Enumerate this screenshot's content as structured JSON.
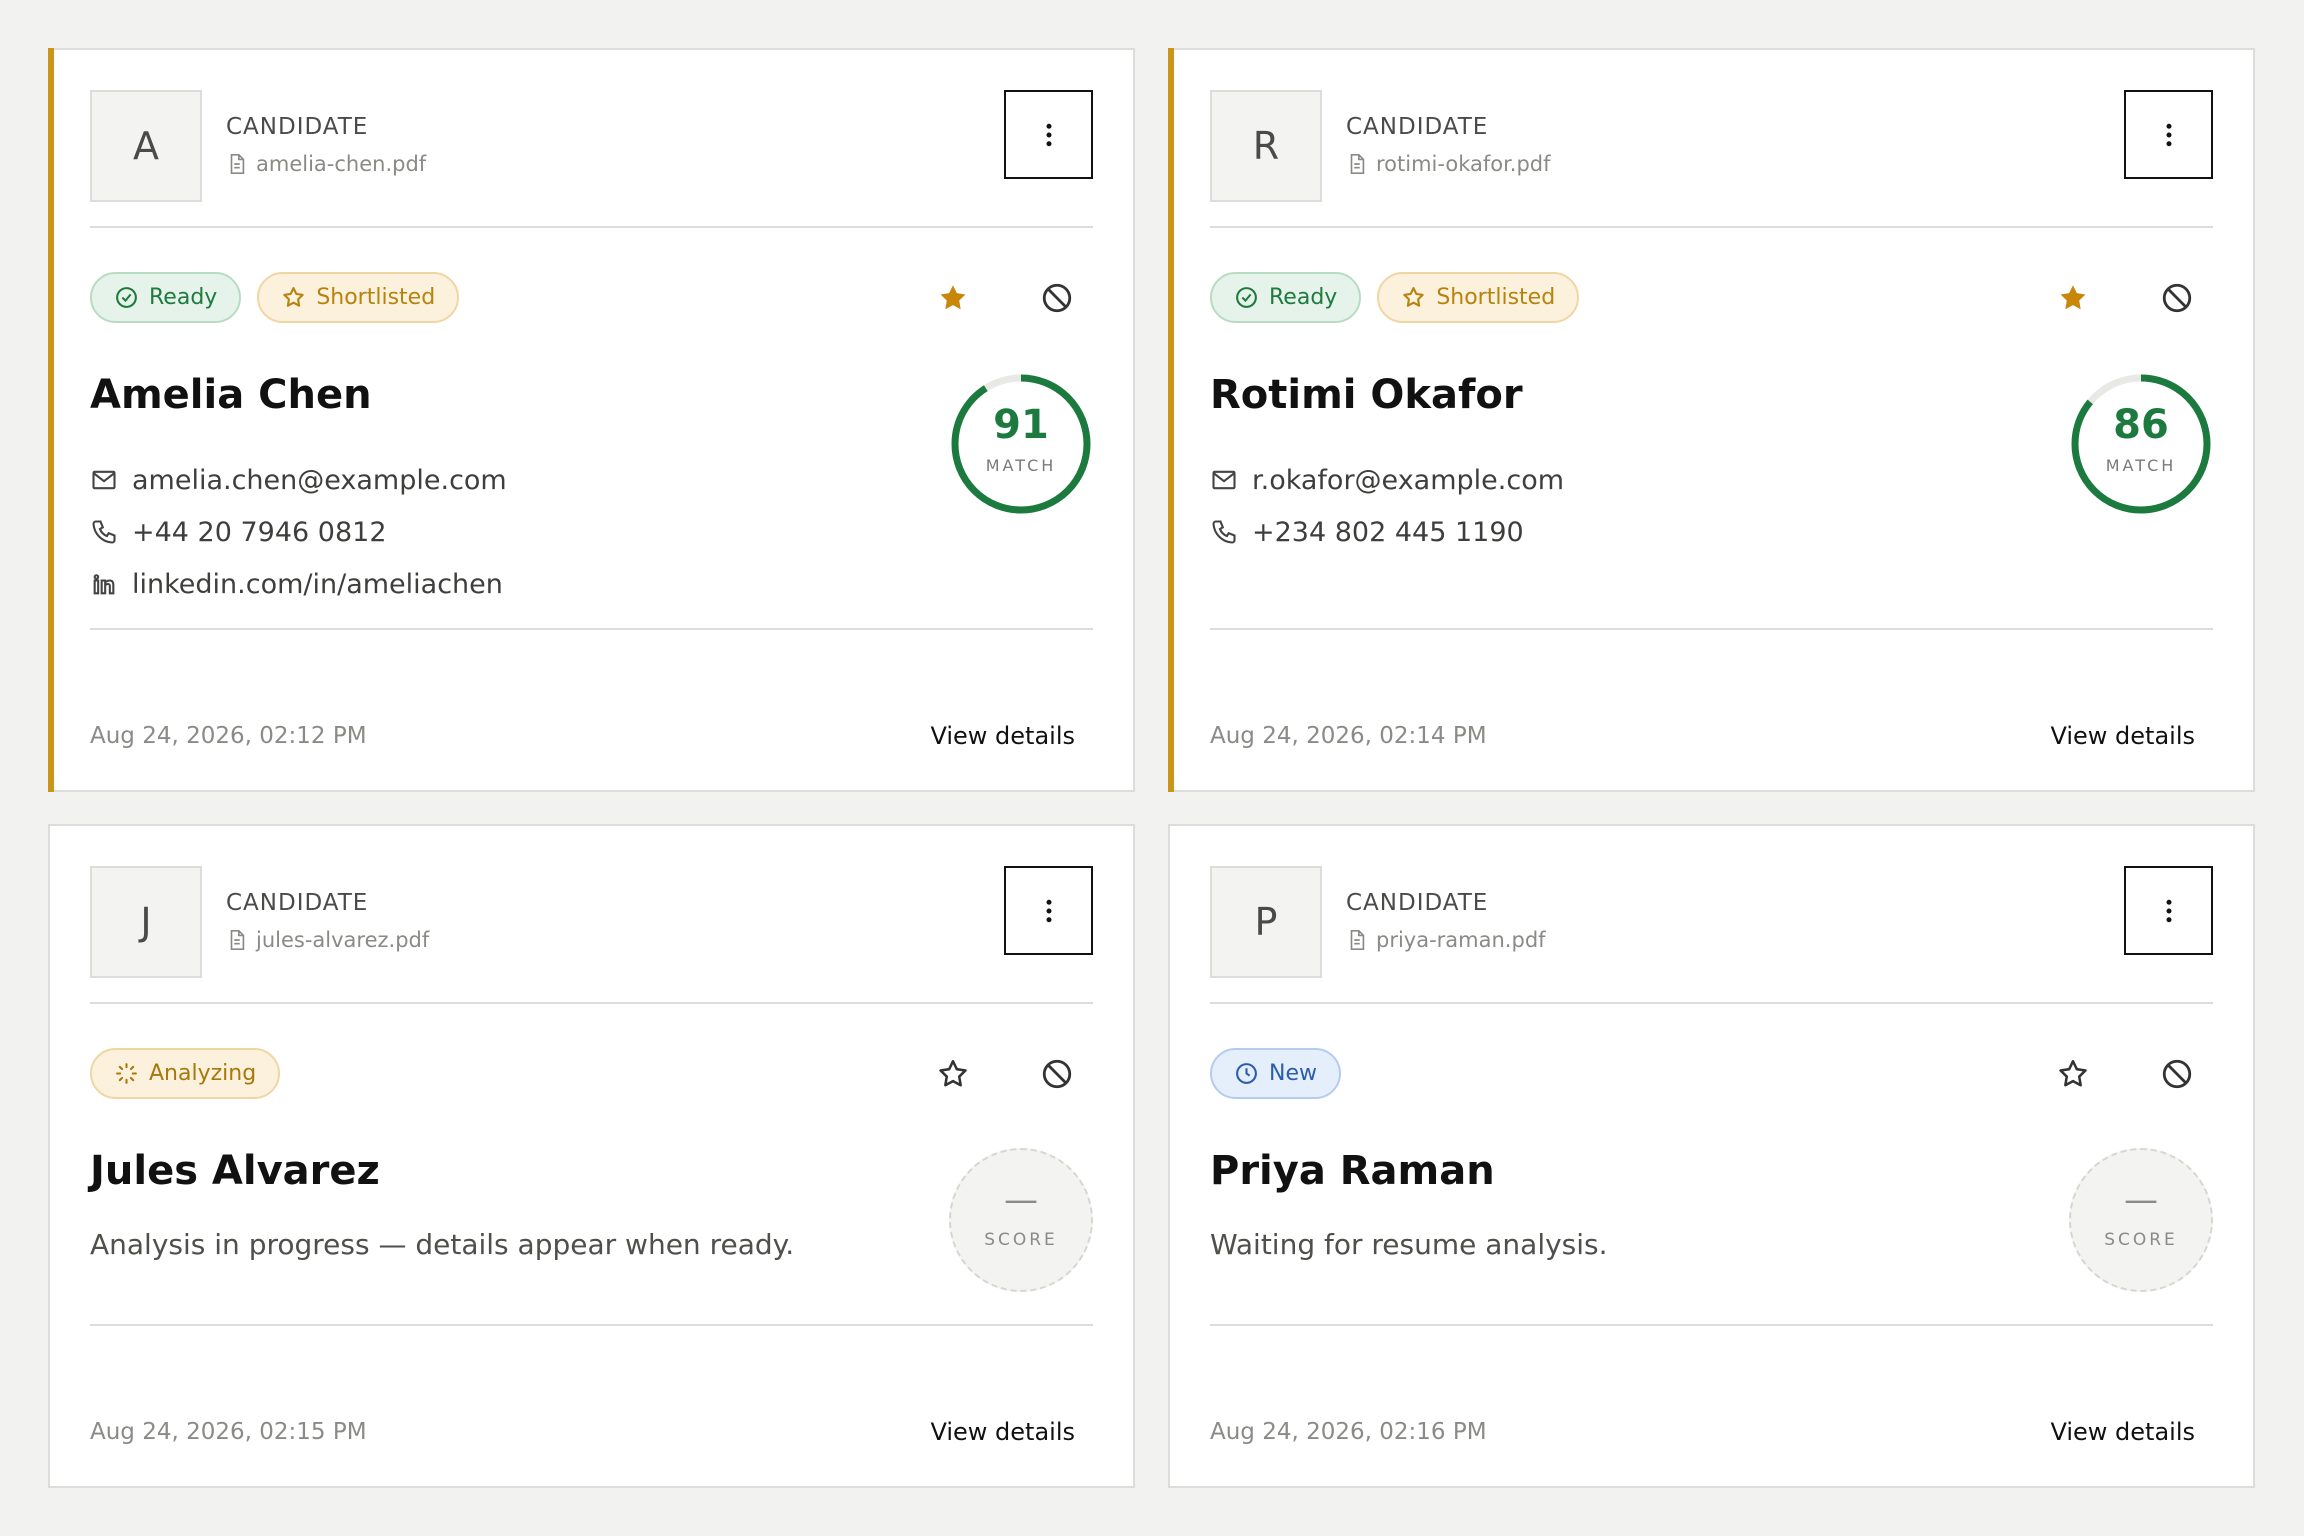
{
  "cards": [
    {
      "initial": "A",
      "label": "CANDIDATE",
      "file": "amelia-chen.pdf",
      "badges": [
        "Ready",
        "Shortlisted"
      ],
      "starred": true,
      "name": "Amelia Chen",
      "email": "amelia.chen@example.com",
      "phone": "+44 20 7946 0812",
      "linkedin": "linkedin.com/in/ameliachen",
      "score": "91",
      "score_label": "MATCH",
      "date": "Aug 24, 2026, 02:12 PM",
      "view": "View details"
    },
    {
      "initial": "R",
      "label": "CANDIDATE",
      "file": "rotimi-okafor.pdf",
      "badges": [
        "Ready",
        "Shortlisted"
      ],
      "starred": true,
      "name": "Rotimi Okafor",
      "email": "r.okafor@example.com",
      "phone": "+234 802 445 1190",
      "score": "86",
      "score_label": "MATCH",
      "date": "Aug 24, 2026, 02:14 PM",
      "view": "View details"
    },
    {
      "initial": "J",
      "label": "CANDIDATE",
      "file": "jules-alvarez.pdf",
      "badges": [
        "Analyzing"
      ],
      "starred": false,
      "name": "Jules Alvarez",
      "description": "Analysis in progress — details appear when ready.",
      "score": "—",
      "score_label": "SCORE",
      "date": "Aug 24, 2026, 02:15 PM",
      "view": "View details"
    },
    {
      "initial": "P",
      "label": "CANDIDATE",
      "file": "priya-raman.pdf",
      "badges": [
        "New"
      ],
      "starred": false,
      "name": "Priya Raman",
      "description": "Waiting for resume analysis.",
      "score": "—",
      "score_label": "SCORE",
      "date": "Aug 24, 2026, 02:16 PM",
      "view": "View details"
    }
  ],
  "colors": {
    "accent": "#c8971a",
    "ready": "#1f7a3f",
    "shortlisted": "#b7830f",
    "new": "#2a5db0",
    "score_ring": "#1c7a3e",
    "star_filled": "#c8860a"
  }
}
